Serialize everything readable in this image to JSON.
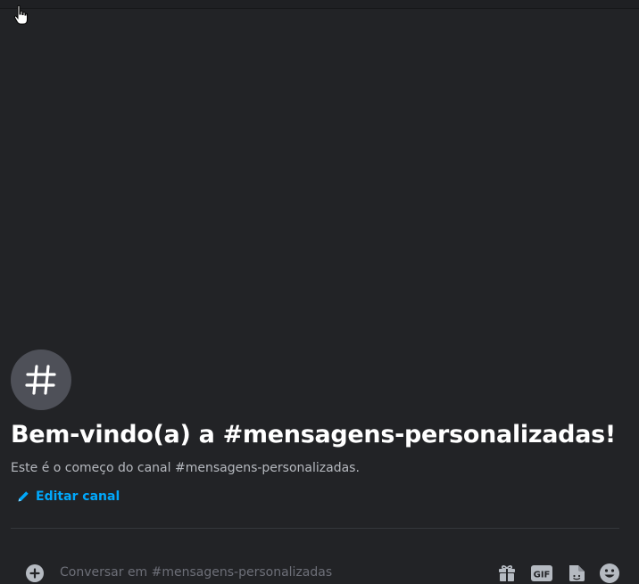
{
  "welcome": {
    "icon": "hashtag-icon",
    "title": "Bem-vindo(a) a #mensagens-personalizadas!",
    "description": "Este é o começo do canal #mensagens-personalizadas.",
    "edit_label": "Editar canal"
  },
  "composer": {
    "placeholder": "Conversar em #mensagens-personalizadas",
    "icons": [
      "plus-circle-icon",
      "gift-icon",
      "gif-icon",
      "sticker-icon",
      "emoji-icon"
    ],
    "gif_label": "GIF"
  },
  "colors": {
    "background": "#222326",
    "link": "#00a8fc",
    "avatar": "#4e5058",
    "title": "#ffffff",
    "muted": "#b6b9bf"
  }
}
